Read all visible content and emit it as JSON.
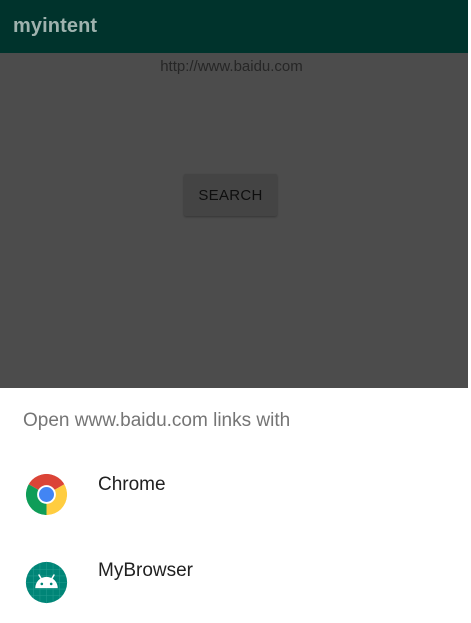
{
  "app_bar": {
    "title": "myintent"
  },
  "content": {
    "url_text": "http://www.baidu.com",
    "search_button_label": "SEARCH"
  },
  "chooser": {
    "title": "Open www.baidu.com links with",
    "apps": [
      {
        "label": "Chrome",
        "icon": "chrome-icon"
      },
      {
        "label": "MyBrowser",
        "icon": "android-icon"
      }
    ]
  },
  "colors": {
    "app_bar": "#00332c",
    "scrim_content": "#4c4c4c",
    "sheet_background": "#ffffff",
    "android_icon_bg": "#008577"
  }
}
